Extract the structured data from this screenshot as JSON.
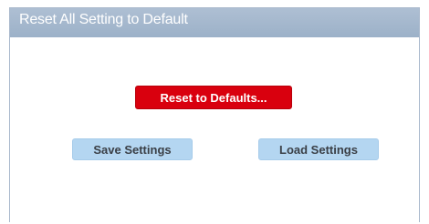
{
  "panel": {
    "title": "Reset All Setting to Default"
  },
  "buttons": {
    "reset_label": "Reset to Defaults...",
    "save_label": "Save Settings",
    "load_label": "Load Settings"
  },
  "colors": {
    "header_bg": "#9cb1c8",
    "reset_button_bg": "#d9000e",
    "secondary_button_bg": "#b4d6f1"
  }
}
